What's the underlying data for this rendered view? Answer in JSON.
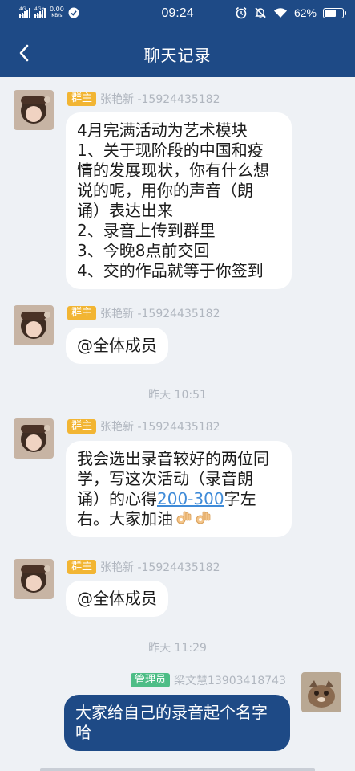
{
  "status_bar": {
    "signal1_label": "4G HD",
    "signal2_label": "4G+ HD",
    "speed_value": "0.00",
    "speed_unit": "KB/s",
    "time": "09:24",
    "battery_text": "62%",
    "battery_level": 0.62,
    "icons": [
      "alarm-icon",
      "mute-icon",
      "wifi-icon",
      "battery-icon",
      "vpn-icon"
    ]
  },
  "header": {
    "title": "聊天记录",
    "back_icon": "chevron-left-icon"
  },
  "messages": [
    {
      "role": "群主",
      "sender": "张艳新 -15924435182",
      "lines": [
        "4月完满活动为艺术模块",
        "1、关于现阶段的中国和疫",
        "情的发展现状，你有什么想",
        "说的呢，用你的声音（朗",
        "诵）表达出来",
        "2、录音上传到群里",
        "3、今晚8点前交回",
        "4、交的作品就等于你签到"
      ]
    },
    {
      "role": "群主",
      "sender": "张艳新 -15924435182",
      "lines": [
        "@全体成员"
      ]
    },
    {
      "role": "群主",
      "sender": "张艳新 -15924435182",
      "lines": [
        "我会选出录音较好的两位同",
        "学，写这次活动（录音朗",
        "诵）的心得"
      ],
      "link_text": "200-300",
      "after_link": "字左",
      "last_line": "右。大家加油",
      "emojis": [
        "ok-hand-emoji",
        "ok-hand-emoji"
      ]
    },
    {
      "role": "群主",
      "sender": "张艳新 -15924435182",
      "lines": [
        "@全体成员"
      ]
    },
    {
      "role": "管理员",
      "sender": "梁文慧13903418743",
      "lines": [
        "大家给自己的录音起个名字",
        "哈"
      ]
    }
  ],
  "timestamps": [
    "昨天 10:51",
    "昨天 11:29"
  ],
  "colors": {
    "header": "#1e4a86",
    "background": "#eef1f5",
    "owner_badge": "#f2b533",
    "admin_badge": "#4dbd86",
    "link": "#3f8bd8",
    "meta_text": "#b0b6bf"
  }
}
